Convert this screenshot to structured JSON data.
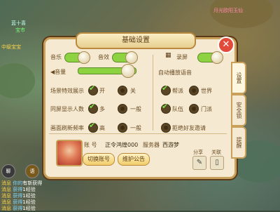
{
  "hud": {
    "top_left_1": "蓝十喜",
    "top_left_2": "宝市",
    "top_right": "月光欧阳玉仙",
    "left_mid": "中级宝宝",
    "gold_label": "罚"
  },
  "chat": {
    "btn_chat": "聊",
    "btn_voice": "语",
    "lines": [
      {
        "tag": "消息",
        "name": "你的",
        "text": "有新获得"
      },
      {
        "tag": "消息",
        "name": "获得",
        "text": "1经验"
      },
      {
        "tag": "消息",
        "name": "获得",
        "text": "1经验"
      },
      {
        "tag": "消息",
        "name": "获得",
        "text": "1经验"
      },
      {
        "tag": "消息",
        "name": "获得",
        "text": "1经验"
      }
    ]
  },
  "panel": {
    "title": "基础设置",
    "close": "✕",
    "music": "音乐",
    "sfx": "音效",
    "record": "录屏",
    "volume": "音量",
    "voice_title": "自动播放语音",
    "scene_effects": "场景特效展示",
    "scene_on": "开",
    "scene_off": "关",
    "same_screen": "同屏显示人数",
    "many": "多",
    "normal": "一般",
    "refresh_rate": "画面刷新频率",
    "high": "高",
    "normal2": "一般",
    "voice_options": [
      "帮派",
      "世界",
      "队伍",
      "门派"
    ],
    "refuse_friend": "拒绝好友邀请",
    "account_label": "账    号",
    "account_value": "正令鸿煌000",
    "server_label": "服务器",
    "server_value": "西游梦",
    "switch_account": "切换账号",
    "maintenance": "维护公告",
    "share": "分享",
    "relate": "关联"
  },
  "tabs": [
    "设置",
    "安全锁",
    "提醒"
  ],
  "state": {
    "music_on": true,
    "sfx_on": true,
    "record_on": true,
    "volume": 0.85,
    "scene_effects": "开",
    "same_screen": "多",
    "refresh_rate": "高",
    "voice_checked": [
      true,
      false,
      true,
      false
    ],
    "refuse_friend": false
  }
}
